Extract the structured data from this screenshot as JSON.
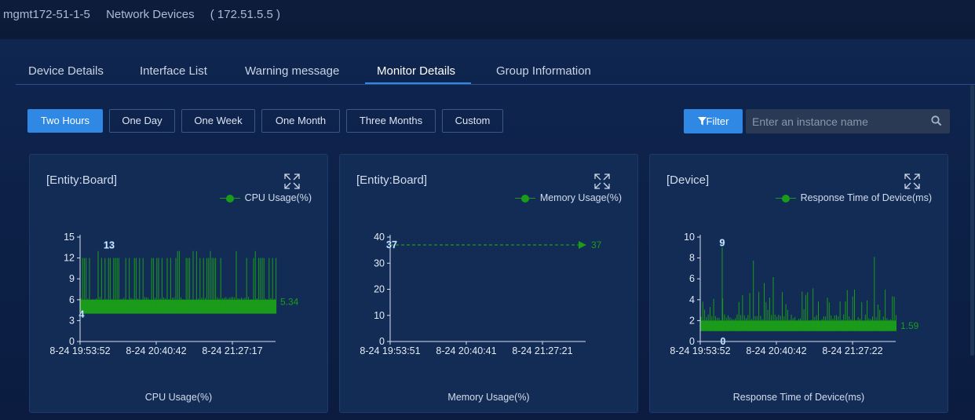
{
  "header": {
    "device_name": "mgmt172-51-1-5",
    "breadcrumb": "Network Devices",
    "ip": "( 172.51.5.5 )"
  },
  "tabs": [
    {
      "label": "Device Details",
      "active": false
    },
    {
      "label": "Interface List",
      "active": false
    },
    {
      "label": "Warning message",
      "active": false
    },
    {
      "label": "Monitor Details",
      "active": true
    },
    {
      "label": "Group Information",
      "active": false
    }
  ],
  "time_ranges": [
    {
      "label": "Two Hours",
      "active": true
    },
    {
      "label": "One Day",
      "active": false
    },
    {
      "label": "One Week",
      "active": false
    },
    {
      "label": "One Month",
      "active": false
    },
    {
      "label": "Three Months",
      "active": false
    },
    {
      "label": "Custom",
      "active": false
    }
  ],
  "filter": {
    "label": "Filter",
    "placeholder": "Enter an instance name"
  },
  "accent_color": "#2f88e4",
  "series_color": "#1a9b1a",
  "cards": [
    {
      "title": "[Entity:Board]",
      "legend": "CPU Usage(%)",
      "bottom_label": "CPU Usage(%)"
    },
    {
      "title": "[Entity:Board]",
      "legend": "Memory Usage(%)",
      "bottom_label": "Memory Usage(%)"
    },
    {
      "title": "[Device]",
      "legend": "Response Time of Device(ms)",
      "bottom_label": "Response Time of Device(ms)"
    }
  ],
  "chart_data": [
    {
      "type": "line",
      "series": [
        {
          "name": "CPU Usage(%)"
        }
      ],
      "yticks": [
        "0",
        "3",
        "6",
        "9",
        "12",
        "15"
      ],
      "ylim": [
        0,
        15
      ],
      "xticks": [
        "8-24 19:53:52",
        "8-24 20:40:42",
        "8-24 21:27:17"
      ],
      "max_label": "13",
      "max": 13,
      "min_label": "4",
      "min": 4,
      "last_label": "5.34",
      "last": 5.34,
      "baseline_range": [
        4,
        6
      ],
      "spike_value": 12
    },
    {
      "type": "line",
      "series": [
        {
          "name": "Memory Usage(%)"
        }
      ],
      "yticks": [
        "0",
        "10",
        "20",
        "30",
        "40"
      ],
      "ylim": [
        0,
        40
      ],
      "xticks": [
        "8-24 19:53:51",
        "8-24 20:40:41",
        "8-24 21:27:21"
      ],
      "max_label": "37",
      "max": 37,
      "last_label": "37",
      "last": 37
    },
    {
      "type": "line",
      "series": [
        {
          "name": "Response Time of Device(ms)"
        }
      ],
      "yticks": [
        "0",
        "2",
        "4",
        "6",
        "8",
        "10"
      ],
      "ylim": [
        0,
        10
      ],
      "xticks": [
        "8-24 19:53:52",
        "8-24 20:40:42",
        "8-24 21:27:22"
      ],
      "max_label": "9",
      "max": 9,
      "min_label": "0",
      "min": 0,
      "last_label": "1.59",
      "last": 1.59,
      "baseline_range": [
        1,
        2
      ]
    }
  ]
}
